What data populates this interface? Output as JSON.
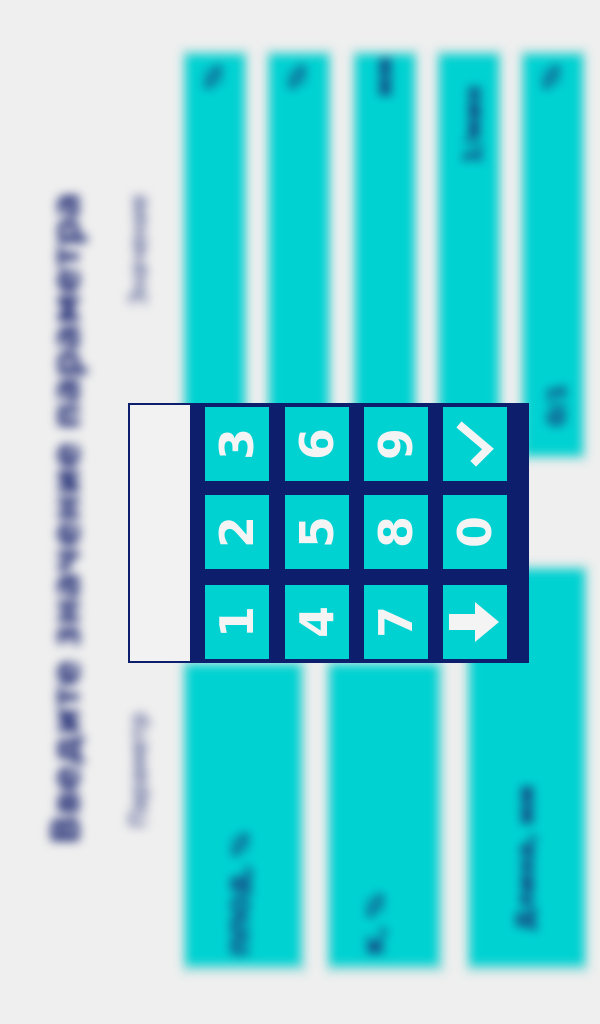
{
  "screen": {
    "title": "Введите значение параметра",
    "headers": {
      "parameter": "Параметр",
      "value": "Значение"
    }
  },
  "rows": [
    {
      "label": "ППОД, %",
      "value": "",
      "unit": "%"
    },
    {
      "label": "К, %",
      "value": "",
      "unit": "%"
    },
    {
      "label": "Длина, мм",
      "value": "",
      "unit": "мм"
    },
    {
      "label": "",
      "value": "",
      "unit": "1/мин"
    },
    {
      "label": "",
      "value": "0/1",
      "unit": "%"
    }
  ],
  "keypad": {
    "display_value": "",
    "keys": [
      "1",
      "2",
      "3",
      "4",
      "5",
      "6",
      "7",
      "8",
      "9",
      "down",
      "0",
      "enter"
    ],
    "colors": {
      "frame": "#0d1f6c",
      "key": "#00d2d2",
      "key_text": "#f4f4f4"
    }
  }
}
